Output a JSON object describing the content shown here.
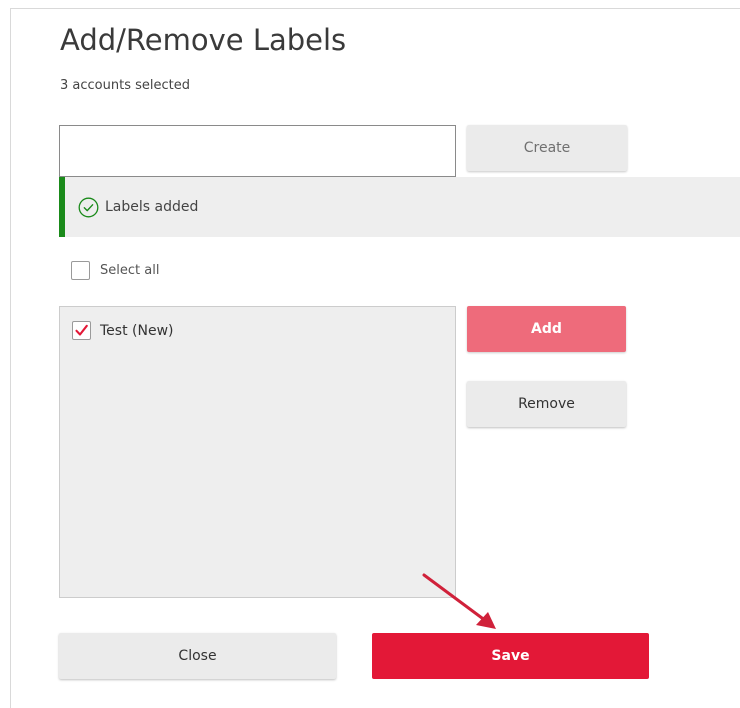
{
  "dialog": {
    "title": "Add/Remove Labels",
    "subtitle": "3 accounts selected"
  },
  "label_input": {
    "value": "",
    "placeholder": ""
  },
  "buttons": {
    "create": "Create",
    "add": "Add",
    "remove": "Remove",
    "close": "Close",
    "save": "Save"
  },
  "alert": {
    "message": "Labels added",
    "icon": "check-circle-icon",
    "status_color": "#1a8a1a"
  },
  "select_all": {
    "label": "Select all",
    "checked": false
  },
  "labels_list": [
    {
      "label": "Test (New)",
      "checked": true
    }
  ],
  "colors": {
    "primary": "#e31837",
    "primary_light": "#ee6b7b",
    "success": "#1a8a1a",
    "annotation_arrow": "#d0213a"
  }
}
